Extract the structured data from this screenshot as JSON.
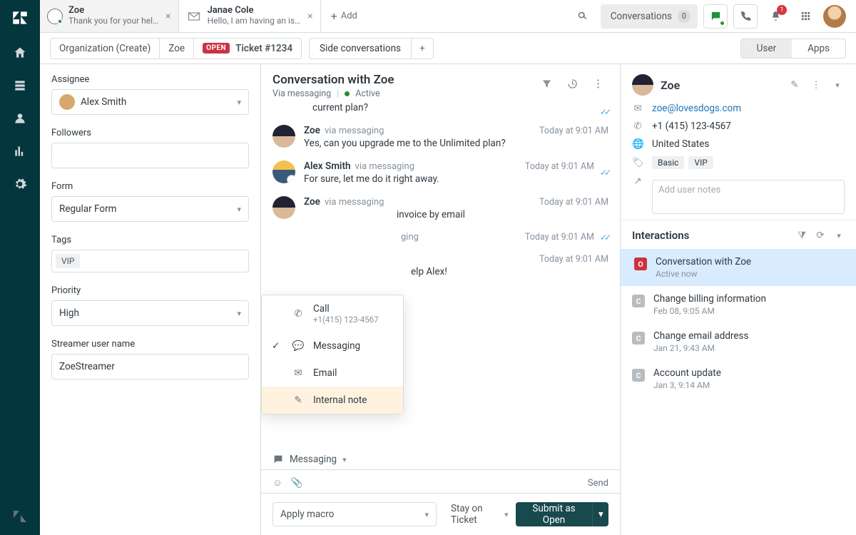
{
  "tabs": [
    {
      "title": "Zoe",
      "subtitle": "Thank you for your hel…",
      "selected": true
    },
    {
      "title": "Janae Cole",
      "subtitle": "Hello, I am having an is…",
      "selected": false
    }
  ],
  "tab_add_label": "Add",
  "top_actions": {
    "conversations_label": "Conversations",
    "conversations_count": "0",
    "notification_count": "1"
  },
  "breadcrumbs": {
    "org": "Organization (Create)",
    "user": "Zoe",
    "status": "OPEN",
    "ticket": "Ticket #1234"
  },
  "side_conversations_label": "Side conversations",
  "right_toggle": {
    "user": "User",
    "apps": "Apps"
  },
  "left_panel": {
    "assignee_label": "Assignee",
    "assignee_value": "Alex Smith",
    "followers_label": "Followers",
    "form_label": "Form",
    "form_value": "Regular Form",
    "tags_label": "Tags",
    "tags": [
      "VIP"
    ],
    "priority_label": "Priority",
    "priority_value": "High",
    "streamer_label": "Streamer user name",
    "streamer_value": "ZoeStreamer"
  },
  "conversation": {
    "title": "Conversation with Zoe",
    "via": "Via messaging",
    "status": "Active",
    "prev_line": "current plan?",
    "messages": [
      {
        "who": "Zoe",
        "avatar": "zoe",
        "via": "via messaging",
        "time": "Today at 9:01 AM",
        "text": "Yes, can you upgrade me to the Unlimited plan?",
        "checked": false
      },
      {
        "who": "Alex Smith",
        "avatar": "alex",
        "via": "via messaging",
        "time": "Today at 9:01 AM",
        "text": "For sure, let me do it right away.",
        "checked": true
      },
      {
        "who": "Zoe",
        "avatar": "zoe",
        "via": "via messaging",
        "time": "Today at 9:01 AM",
        "text": "invoice by email",
        "checked": false
      },
      {
        "who": "",
        "avatar": "",
        "via": "ging",
        "time": "Today at 9:01 AM",
        "text": "",
        "checked": true
      },
      {
        "who": "",
        "avatar": "",
        "via": "",
        "time": "Today at 9:01 AM",
        "text": "elp Alex!",
        "checked": false
      }
    ]
  },
  "channel_popup": {
    "items": [
      {
        "icon": "phone",
        "label": "Call",
        "sub": "+1(415) 123-4567"
      },
      {
        "icon": "message",
        "label": "Messaging",
        "checked": true
      },
      {
        "icon": "email",
        "label": "Email"
      },
      {
        "icon": "note",
        "label": "Internal note",
        "highlight": true
      }
    ]
  },
  "composer": {
    "channel_label": "Messaging",
    "send_label": "Send"
  },
  "footer": {
    "macro_label": "Apply macro",
    "stay_label": "Stay on Ticket",
    "submit_label": "Submit as Open"
  },
  "user_panel": {
    "name": "Zoe",
    "email": "zoe@lovesdogs.com",
    "phone": "+1 (415) 123-4567",
    "location": "United States",
    "badges": [
      "Basic",
      "VIP"
    ],
    "notes_placeholder": "Add user notes"
  },
  "interactions_header": "Interactions",
  "interactions": [
    {
      "status": "open",
      "letter": "O",
      "title": "Conversation with Zoe",
      "sub": "Active now",
      "selected": true
    },
    {
      "status": "closed",
      "letter": "C",
      "title": "Change billing information",
      "sub": "Feb 08, 9:05 AM"
    },
    {
      "status": "closed",
      "letter": "C",
      "title": "Change email address",
      "sub": "Jan 21, 9:43 AM"
    },
    {
      "status": "closed",
      "letter": "C",
      "title": "Account update",
      "sub": "Jan 3, 9:14 AM"
    }
  ]
}
